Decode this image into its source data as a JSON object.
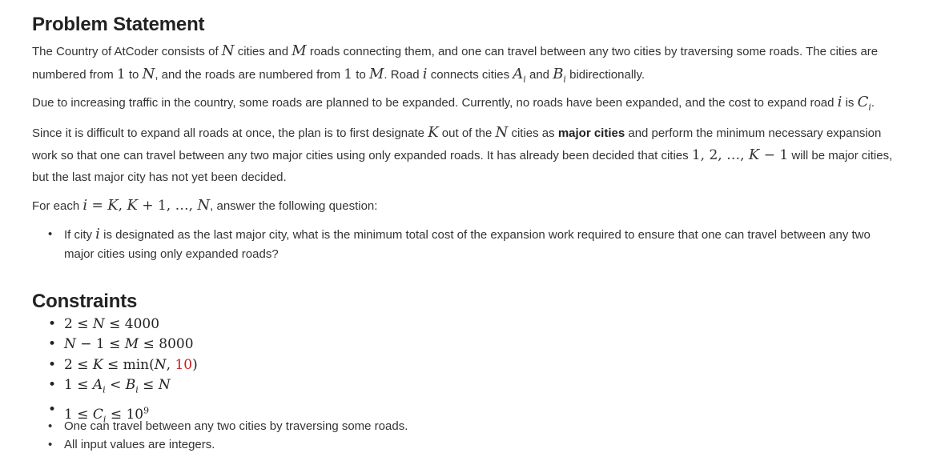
{
  "headings": {
    "problem": "Problem Statement",
    "constraints": "Constraints"
  },
  "p1": {
    "t1": "The Country of AtCoder consists of ",
    "t2": " cities and ",
    "t3": " roads connecting them, and one can travel between any two cities by traversing some roads. The cities are numbered from ",
    "t4": " to ",
    "t5": ", and the roads are numbered from ",
    "t6": " to ",
    "t7": ". Road ",
    "t8": " connects cities ",
    "t9": " and ",
    "t10": " bidirectionally."
  },
  "p2": {
    "t1": "Due to increasing traffic in the country, some roads are planned to be expanded. Currently, no roads have been expanded, and the cost to expand road ",
    "t2": " is ",
    "t3": "."
  },
  "p3": {
    "t1": "Since it is difficult to expand all roads at once, the plan is to first designate ",
    "t2": " out of the ",
    "t3": " cities as ",
    "bold": "major cities",
    "t4": " and perform the minimum necessary expansion work so that one can travel between any two major cities using only expanded roads. It has already been decided that cities ",
    "t5": " will be major cities, but the last major city has not yet been decided."
  },
  "p4": {
    "t1": "For each ",
    "t2": ", answer the following question:"
  },
  "question": "If city i is designated as the last major city, what is the minimum total cost of the expansion work required to ensure that one can travel between any two major cities using only expanded roads?",
  "question_parts": {
    "t1": "If city ",
    "t2": " is designated as the last major city, what is the minimum total cost of the expansion work required to ensure that one can travel between any two major cities using only expanded roads?"
  },
  "constraints_math": [
    "2 ≤ N ≤ 4000",
    "N − 1 ≤ M ≤ 8000",
    "2 ≤ K ≤ min(N, 10)",
    "1 ≤ Aᵢ < Bᵢ ≤ N",
    "1 ≤ Cᵢ ≤ 10⁹"
  ],
  "constraints_text": [
    "One can travel between any two cities by traversing some roads.",
    "All input values are integers."
  ],
  "bullet": "•",
  "colors": {
    "text": "#333333",
    "heading": "#222222",
    "highlight": "#c81c1c"
  }
}
